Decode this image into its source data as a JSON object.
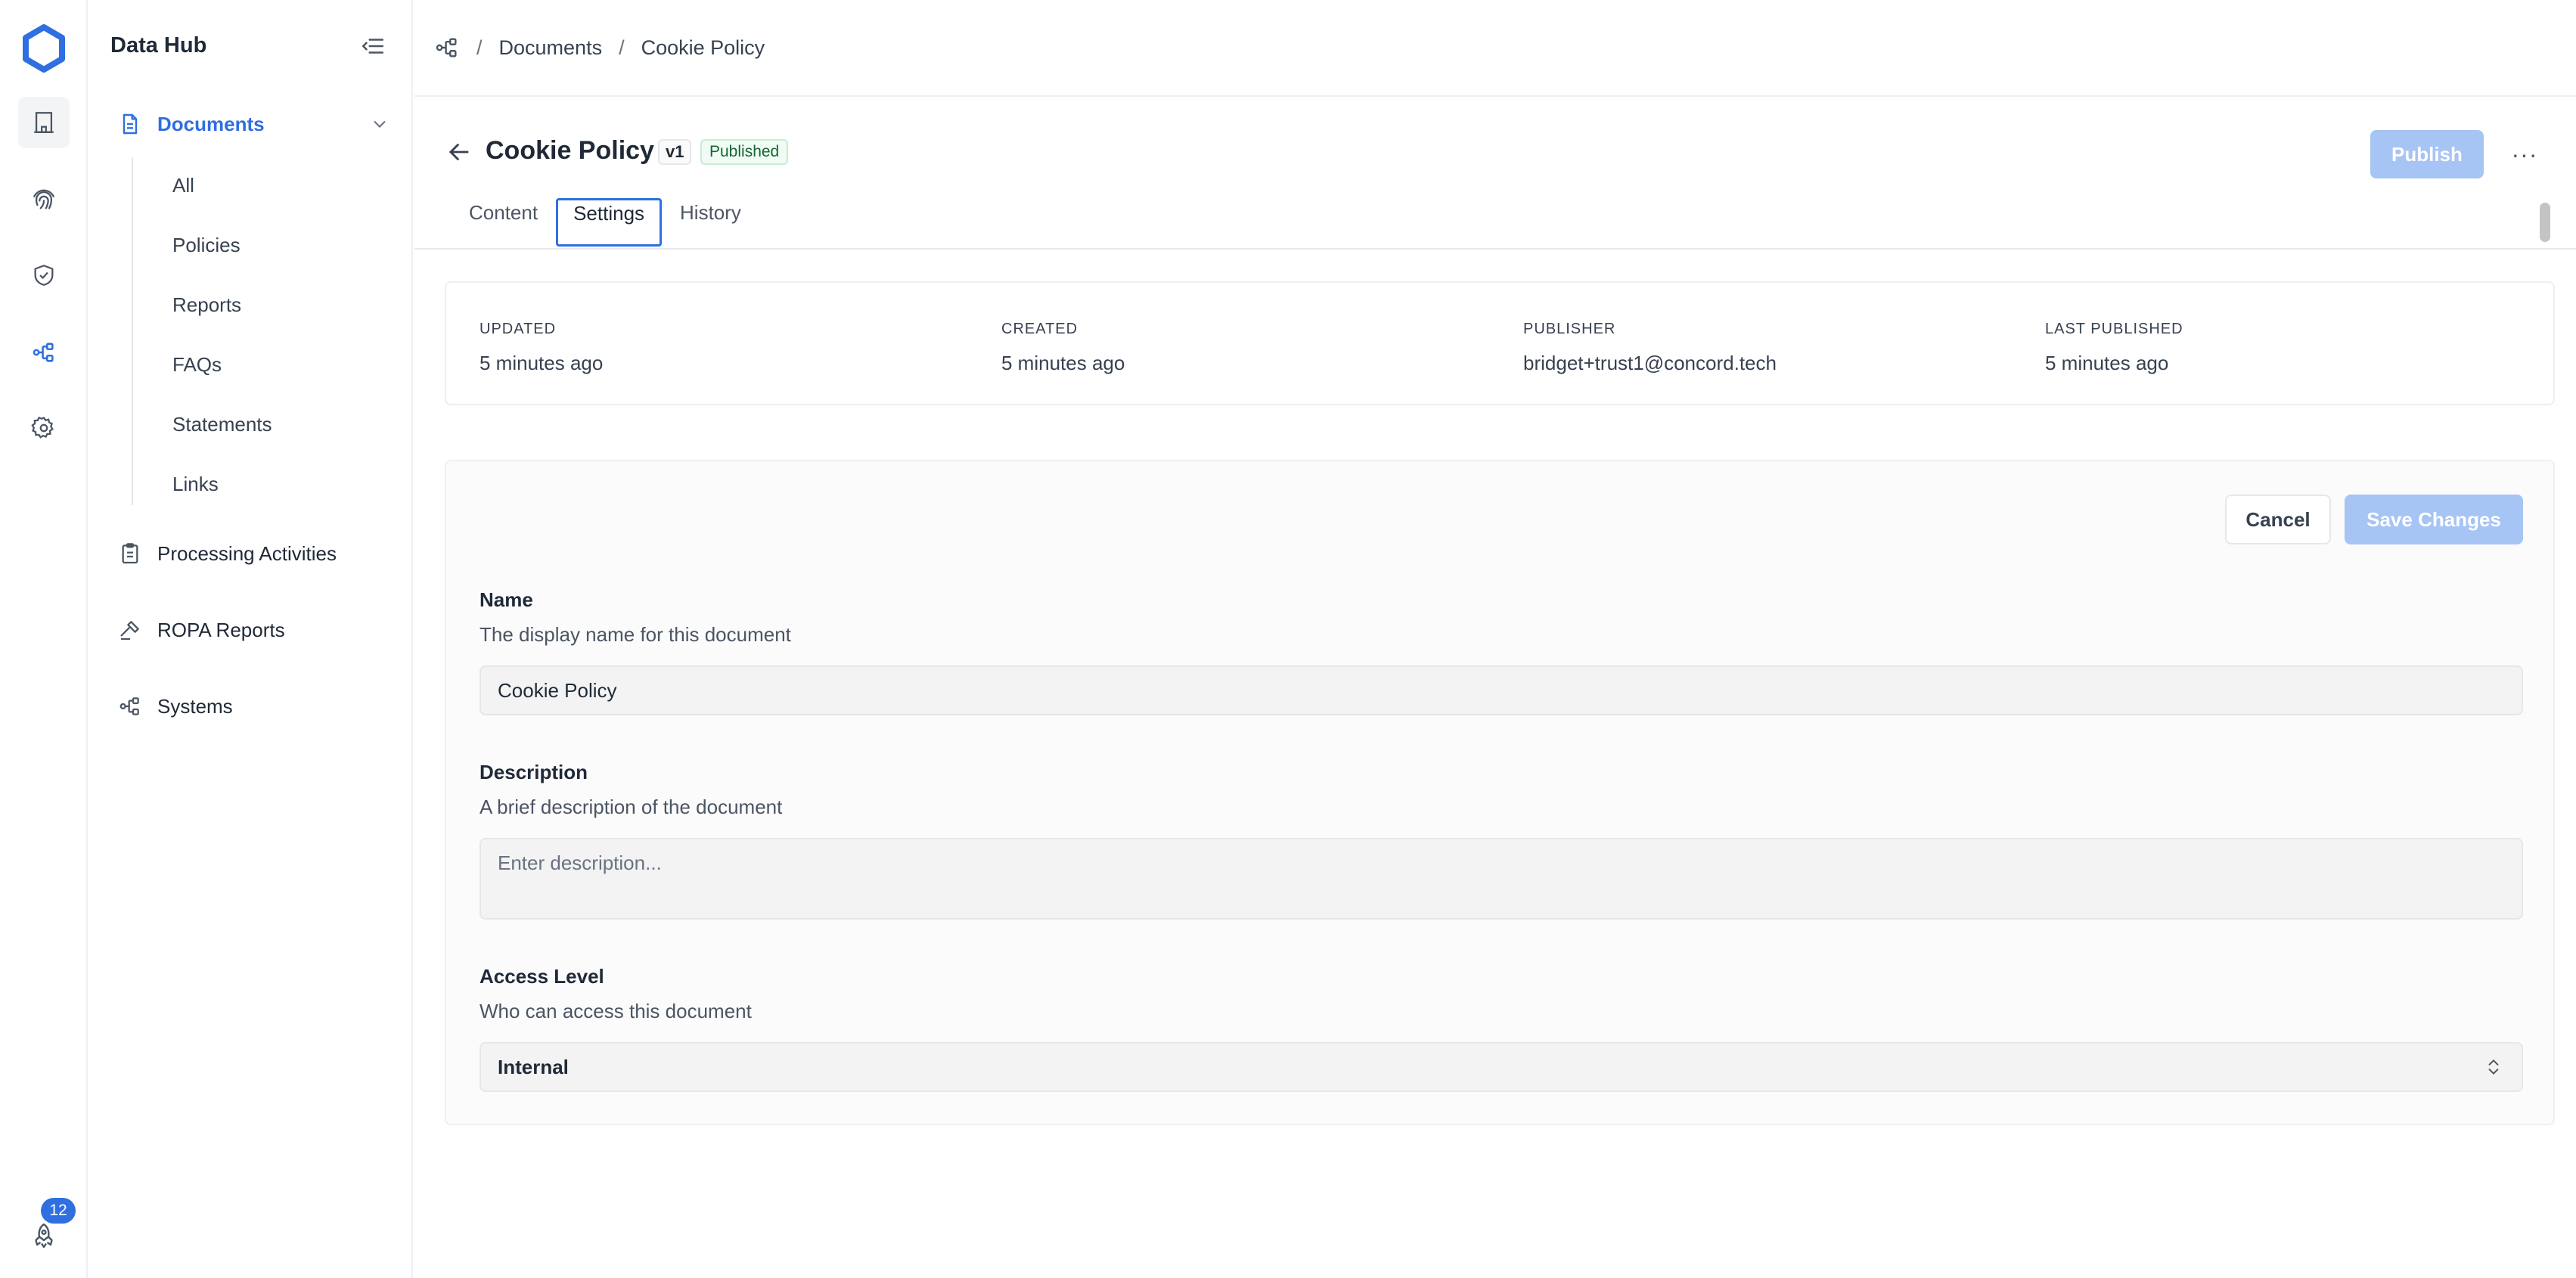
{
  "app": {
    "title": "Data Hub",
    "accent": "#2f6fe0"
  },
  "rail": {
    "notification_count": "12"
  },
  "sidebar": {
    "title": "Data Hub",
    "group": {
      "label": "Documents",
      "icon": "document-icon"
    },
    "sub_items": [
      "All",
      "Policies",
      "Reports",
      "FAQs",
      "Statements",
      "Links"
    ],
    "items": [
      {
        "label": "Processing Activities",
        "icon": "clipboard-icon"
      },
      {
        "label": "ROPA Reports",
        "icon": "gavel-icon"
      },
      {
        "label": "Systems",
        "icon": "systems-icon"
      }
    ]
  },
  "breadcrumb": {
    "items": [
      "Documents",
      "Cookie Policy"
    ],
    "separator": "/"
  },
  "header": {
    "title": "Cookie Policy",
    "version": "v1",
    "status": "Published",
    "publish_label": "Publish",
    "more_label": "···",
    "tabs": [
      "Content",
      "Settings",
      "History"
    ],
    "active_tab": "Settings"
  },
  "meta": {
    "updated": {
      "label": "UPDATED",
      "value": "5 minutes ago"
    },
    "created": {
      "label": "CREATED",
      "value": "5 minutes ago"
    },
    "publisher": {
      "label": "PUBLISHER",
      "value": "bridget+trust1@concord.tech"
    },
    "last_published": {
      "label": "LAST PUBLISHED",
      "value": "5 minutes ago"
    }
  },
  "form": {
    "cancel_label": "Cancel",
    "save_label": "Save Changes",
    "name": {
      "label": "Name",
      "help": "The display name for this document",
      "value": "Cookie Policy"
    },
    "description": {
      "label": "Description",
      "help": "A brief description of the document",
      "placeholder": "Enter description..."
    },
    "access": {
      "label": "Access Level",
      "help": "Who can access this document",
      "value": "Internal"
    }
  }
}
